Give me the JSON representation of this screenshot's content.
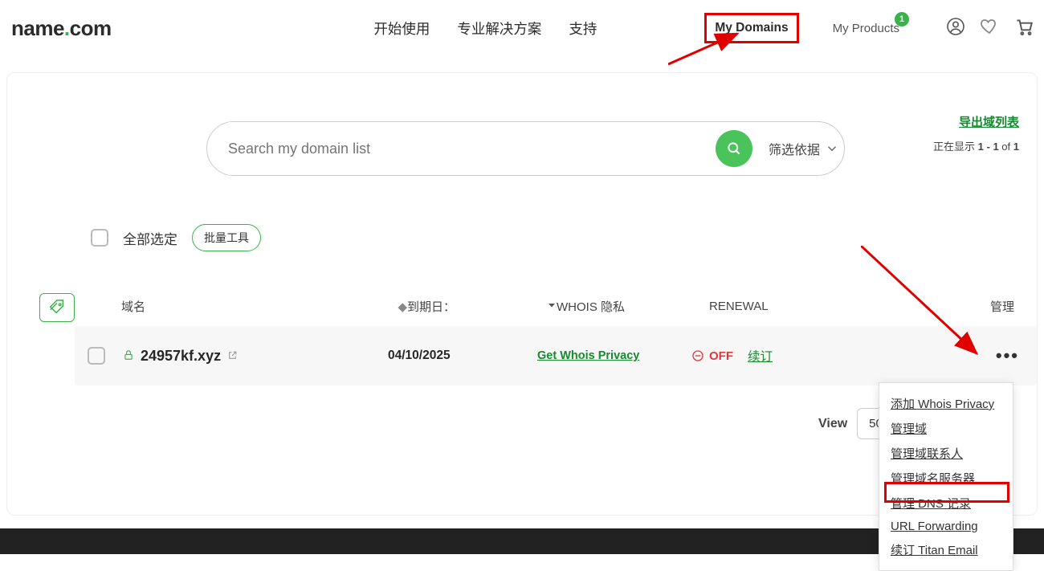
{
  "logo": {
    "part1": "name",
    "dot": ".",
    "part2": "com"
  },
  "nav": {
    "start": "开始使用",
    "solutions": "专业解决方案",
    "support": "支持",
    "my_domains": "My Domains",
    "my_products": "My Products",
    "badge_count": "1"
  },
  "search": {
    "placeholder": "Search my domain list",
    "filter": "筛选依据"
  },
  "export": {
    "link": "导出域列表",
    "showing_prefix": "正在显示 ",
    "range": "1 - 1",
    "of": " of ",
    "total": "1"
  },
  "tools": {
    "select_all": "全部选定",
    "bulk": "批量工具"
  },
  "headers": {
    "domain": "域名",
    "expire": "到期日：",
    "whois": "WHOIS 隐私",
    "renewal": "RENEWAL",
    "manage": "管理"
  },
  "row": {
    "domain": "24957kf.xyz",
    "expire": "04/10/2025",
    "whois_link": "Get Whois Privacy",
    "off": "OFF",
    "renew": "续订"
  },
  "view": {
    "label": "View",
    "value": "50"
  },
  "menu": {
    "add_whois": "添加 Whois Privacy",
    "manage_domain": "管理域",
    "manage_contacts": "管理域联系人",
    "manage_ns": "管理域名服务器",
    "manage_dns": "管理 DNS 记录",
    "url_fwd": "URL Forwarding",
    "titan": "续订 Titan Email"
  }
}
